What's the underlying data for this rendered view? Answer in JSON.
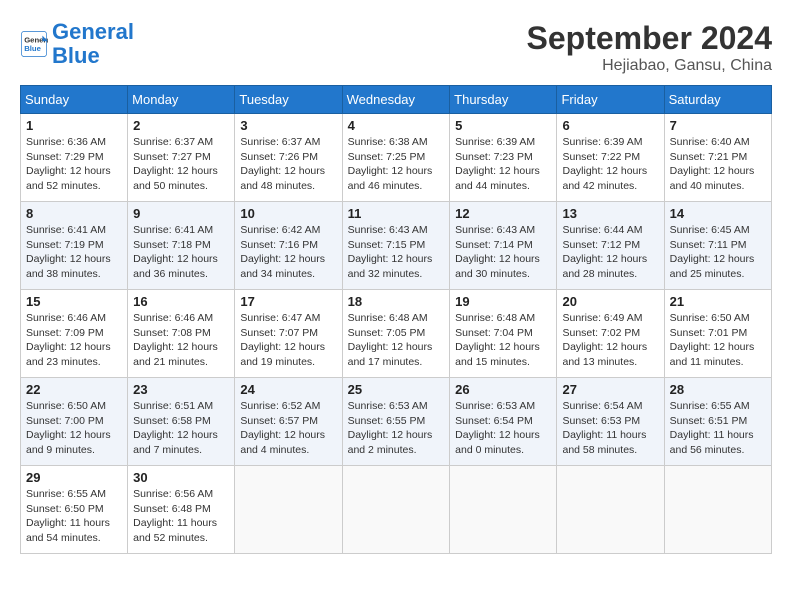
{
  "header": {
    "logo_line1": "General",
    "logo_line2": "Blue",
    "month": "September 2024",
    "location": "Hejiabao, Gansu, China"
  },
  "weekdays": [
    "Sunday",
    "Monday",
    "Tuesday",
    "Wednesday",
    "Thursday",
    "Friday",
    "Saturday"
  ],
  "weeks": [
    [
      {
        "day": "1",
        "sunrise": "6:36 AM",
        "sunset": "7:29 PM",
        "daylight": "12 hours and 52 minutes."
      },
      {
        "day": "2",
        "sunrise": "6:37 AM",
        "sunset": "7:27 PM",
        "daylight": "12 hours and 50 minutes."
      },
      {
        "day": "3",
        "sunrise": "6:37 AM",
        "sunset": "7:26 PM",
        "daylight": "12 hours and 48 minutes."
      },
      {
        "day": "4",
        "sunrise": "6:38 AM",
        "sunset": "7:25 PM",
        "daylight": "12 hours and 46 minutes."
      },
      {
        "day": "5",
        "sunrise": "6:39 AM",
        "sunset": "7:23 PM",
        "daylight": "12 hours and 44 minutes."
      },
      {
        "day": "6",
        "sunrise": "6:39 AM",
        "sunset": "7:22 PM",
        "daylight": "12 hours and 42 minutes."
      },
      {
        "day": "7",
        "sunrise": "6:40 AM",
        "sunset": "7:21 PM",
        "daylight": "12 hours and 40 minutes."
      }
    ],
    [
      {
        "day": "8",
        "sunrise": "6:41 AM",
        "sunset": "7:19 PM",
        "daylight": "12 hours and 38 minutes."
      },
      {
        "day": "9",
        "sunrise": "6:41 AM",
        "sunset": "7:18 PM",
        "daylight": "12 hours and 36 minutes."
      },
      {
        "day": "10",
        "sunrise": "6:42 AM",
        "sunset": "7:16 PM",
        "daylight": "12 hours and 34 minutes."
      },
      {
        "day": "11",
        "sunrise": "6:43 AM",
        "sunset": "7:15 PM",
        "daylight": "12 hours and 32 minutes."
      },
      {
        "day": "12",
        "sunrise": "6:43 AM",
        "sunset": "7:14 PM",
        "daylight": "12 hours and 30 minutes."
      },
      {
        "day": "13",
        "sunrise": "6:44 AM",
        "sunset": "7:12 PM",
        "daylight": "12 hours and 28 minutes."
      },
      {
        "day": "14",
        "sunrise": "6:45 AM",
        "sunset": "7:11 PM",
        "daylight": "12 hours and 25 minutes."
      }
    ],
    [
      {
        "day": "15",
        "sunrise": "6:46 AM",
        "sunset": "7:09 PM",
        "daylight": "12 hours and 23 minutes."
      },
      {
        "day": "16",
        "sunrise": "6:46 AM",
        "sunset": "7:08 PM",
        "daylight": "12 hours and 21 minutes."
      },
      {
        "day": "17",
        "sunrise": "6:47 AM",
        "sunset": "7:07 PM",
        "daylight": "12 hours and 19 minutes."
      },
      {
        "day": "18",
        "sunrise": "6:48 AM",
        "sunset": "7:05 PM",
        "daylight": "12 hours and 17 minutes."
      },
      {
        "day": "19",
        "sunrise": "6:48 AM",
        "sunset": "7:04 PM",
        "daylight": "12 hours and 15 minutes."
      },
      {
        "day": "20",
        "sunrise": "6:49 AM",
        "sunset": "7:02 PM",
        "daylight": "12 hours and 13 minutes."
      },
      {
        "day": "21",
        "sunrise": "6:50 AM",
        "sunset": "7:01 PM",
        "daylight": "12 hours and 11 minutes."
      }
    ],
    [
      {
        "day": "22",
        "sunrise": "6:50 AM",
        "sunset": "7:00 PM",
        "daylight": "12 hours and 9 minutes."
      },
      {
        "day": "23",
        "sunrise": "6:51 AM",
        "sunset": "6:58 PM",
        "daylight": "12 hours and 7 minutes."
      },
      {
        "day": "24",
        "sunrise": "6:52 AM",
        "sunset": "6:57 PM",
        "daylight": "12 hours and 4 minutes."
      },
      {
        "day": "25",
        "sunrise": "6:53 AM",
        "sunset": "6:55 PM",
        "daylight": "12 hours and 2 minutes."
      },
      {
        "day": "26",
        "sunrise": "6:53 AM",
        "sunset": "6:54 PM",
        "daylight": "12 hours and 0 minutes."
      },
      {
        "day": "27",
        "sunrise": "6:54 AM",
        "sunset": "6:53 PM",
        "daylight": "11 hours and 58 minutes."
      },
      {
        "day": "28",
        "sunrise": "6:55 AM",
        "sunset": "6:51 PM",
        "daylight": "11 hours and 56 minutes."
      }
    ],
    [
      {
        "day": "29",
        "sunrise": "6:55 AM",
        "sunset": "6:50 PM",
        "daylight": "11 hours and 54 minutes."
      },
      {
        "day": "30",
        "sunrise": "6:56 AM",
        "sunset": "6:48 PM",
        "daylight": "11 hours and 52 minutes."
      },
      null,
      null,
      null,
      null,
      null
    ]
  ]
}
